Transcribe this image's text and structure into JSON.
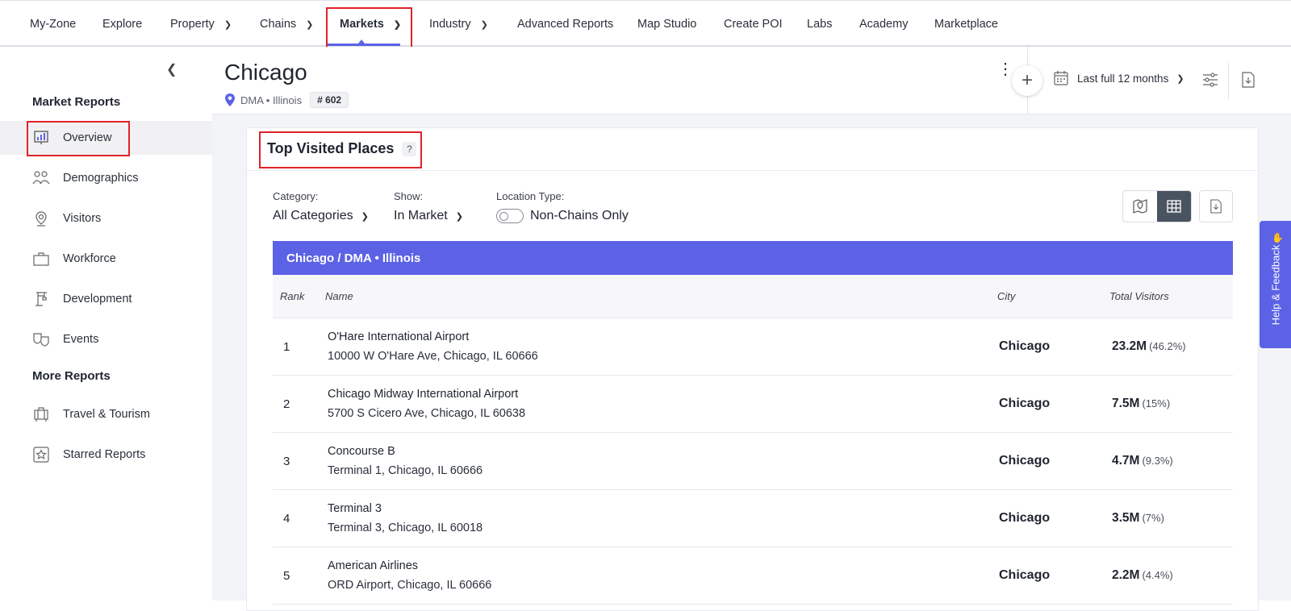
{
  "nav": {
    "items": [
      {
        "label": "My-Zone",
        "dropdown": false
      },
      {
        "label": "Explore",
        "dropdown": false
      },
      {
        "label": "Property",
        "dropdown": true
      },
      {
        "label": "Chains",
        "dropdown": true
      },
      {
        "label": "Markets",
        "dropdown": true,
        "active": true
      },
      {
        "label": "Industry",
        "dropdown": true
      },
      {
        "label": "Advanced Reports",
        "dropdown": false
      },
      {
        "label": "Map Studio",
        "dropdown": false
      },
      {
        "label": "Create POI",
        "dropdown": false
      },
      {
        "label": "Labs",
        "dropdown": false
      },
      {
        "label": "Academy",
        "dropdown": false
      },
      {
        "label": "Marketplace",
        "dropdown": false
      }
    ]
  },
  "sidebar": {
    "market_reports_title": "Market Reports",
    "market_items": [
      {
        "label": "Overview",
        "icon": "chart-icon",
        "active": true
      },
      {
        "label": "Demographics",
        "icon": "people-icon"
      },
      {
        "label": "Visitors",
        "icon": "visitor-pin-icon"
      },
      {
        "label": "Workforce",
        "icon": "briefcase-icon"
      },
      {
        "label": "Development",
        "icon": "crane-icon"
      },
      {
        "label": "Events",
        "icon": "theater-masks-icon"
      }
    ],
    "more_reports_title": "More Reports",
    "more_items": [
      {
        "label": "Travel & Tourism",
        "icon": "luggage-icon"
      },
      {
        "label": "Starred Reports",
        "icon": "star-icon"
      }
    ]
  },
  "header": {
    "title": "Chicago",
    "location": "DMA • Illinois",
    "rank": "# 602",
    "date_range": "Last full 12 months"
  },
  "card": {
    "title": "Top Visited Places",
    "help": "?",
    "filters": {
      "category_label": "Category:",
      "category_value": "All Categories",
      "show_label": "Show:",
      "show_value": "In Market",
      "location_type_label": "Location Type:",
      "location_type_value": "Non-Chains Only",
      "location_type_on": false
    },
    "table_title": "Chicago / DMA • Illinois",
    "columns": {
      "rank": "Rank",
      "name": "Name",
      "city": "City",
      "visitors": "Total Visitors"
    },
    "rows": [
      {
        "rank": "1",
        "name": "O'Hare International Airport",
        "address": "10000 W O'Hare Ave, Chicago, IL 60666",
        "city": "Chicago",
        "visitors": "23.2M",
        "pct": "(46.2%)"
      },
      {
        "rank": "2",
        "name": "Chicago Midway International Airport",
        "address": "5700 S Cicero Ave, Chicago, IL 60638",
        "city": "Chicago",
        "visitors": "7.5M",
        "pct": "(15%)"
      },
      {
        "rank": "3",
        "name": "Concourse B",
        "address": "Terminal 1, Chicago, IL 60666",
        "city": "Chicago",
        "visitors": "4.7M",
        "pct": "(9.3%)"
      },
      {
        "rank": "4",
        "name": "Terminal 3",
        "address": "Terminal 3, Chicago, IL 60018",
        "city": "Chicago",
        "visitors": "3.5M",
        "pct": "(7%)"
      },
      {
        "rank": "5",
        "name": "American Airlines",
        "address": "ORD Airport, Chicago, IL 60666",
        "city": "Chicago",
        "visitors": "2.2M",
        "pct": "(4.4%)"
      }
    ]
  },
  "help_tab": {
    "label": "Help & Feedback"
  },
  "colors": {
    "accent": "#5c62e6",
    "highlight": "#e0222a"
  }
}
